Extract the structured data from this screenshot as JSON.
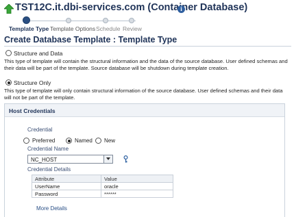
{
  "header": {
    "title": "TST12C.it.dbi-services.com (Container Database)",
    "info_icon": "info-icon",
    "target_icon": "green-up-arrow-icon"
  },
  "train": {
    "steps": [
      "Template Type",
      "Template Options",
      "Schedule",
      "Review"
    ],
    "current_step": 1
  },
  "page": {
    "title": "Create Database Template : Template Type"
  },
  "template_type": {
    "options": [
      {
        "label": "Structure and Data",
        "selected": false,
        "description": "This type of template will contain the structural information and the data of the source database. User defined schemas and their data will be part of the template. Source database will be shutdown during template creation."
      },
      {
        "label": "Structure Only",
        "selected": true,
        "description": "This type of template will only contain structural information of the source database. User defined schemas and their data will not be part of the template."
      }
    ]
  },
  "host_credentials": {
    "title": "Host Credentials",
    "credential_label": "Credential",
    "credential_options": [
      {
        "label": "Preferred",
        "selected": false
      },
      {
        "label": "Named",
        "selected": true
      },
      {
        "label": "New",
        "selected": false
      }
    ],
    "credential_name_label": "Credential Name",
    "credential_name_value": "NC_HOST",
    "details_label": "Credential Details",
    "details_columns": [
      "Attribute",
      "Value"
    ],
    "details_rows": [
      {
        "attribute": "UserName",
        "value": "oracle"
      },
      {
        "attribute": "Password",
        "value": "******"
      }
    ],
    "more_details_link": "More Details"
  },
  "colors": {
    "heading": "#1f3358",
    "train_active": "#2b4f82",
    "link": "#2a4f86"
  }
}
